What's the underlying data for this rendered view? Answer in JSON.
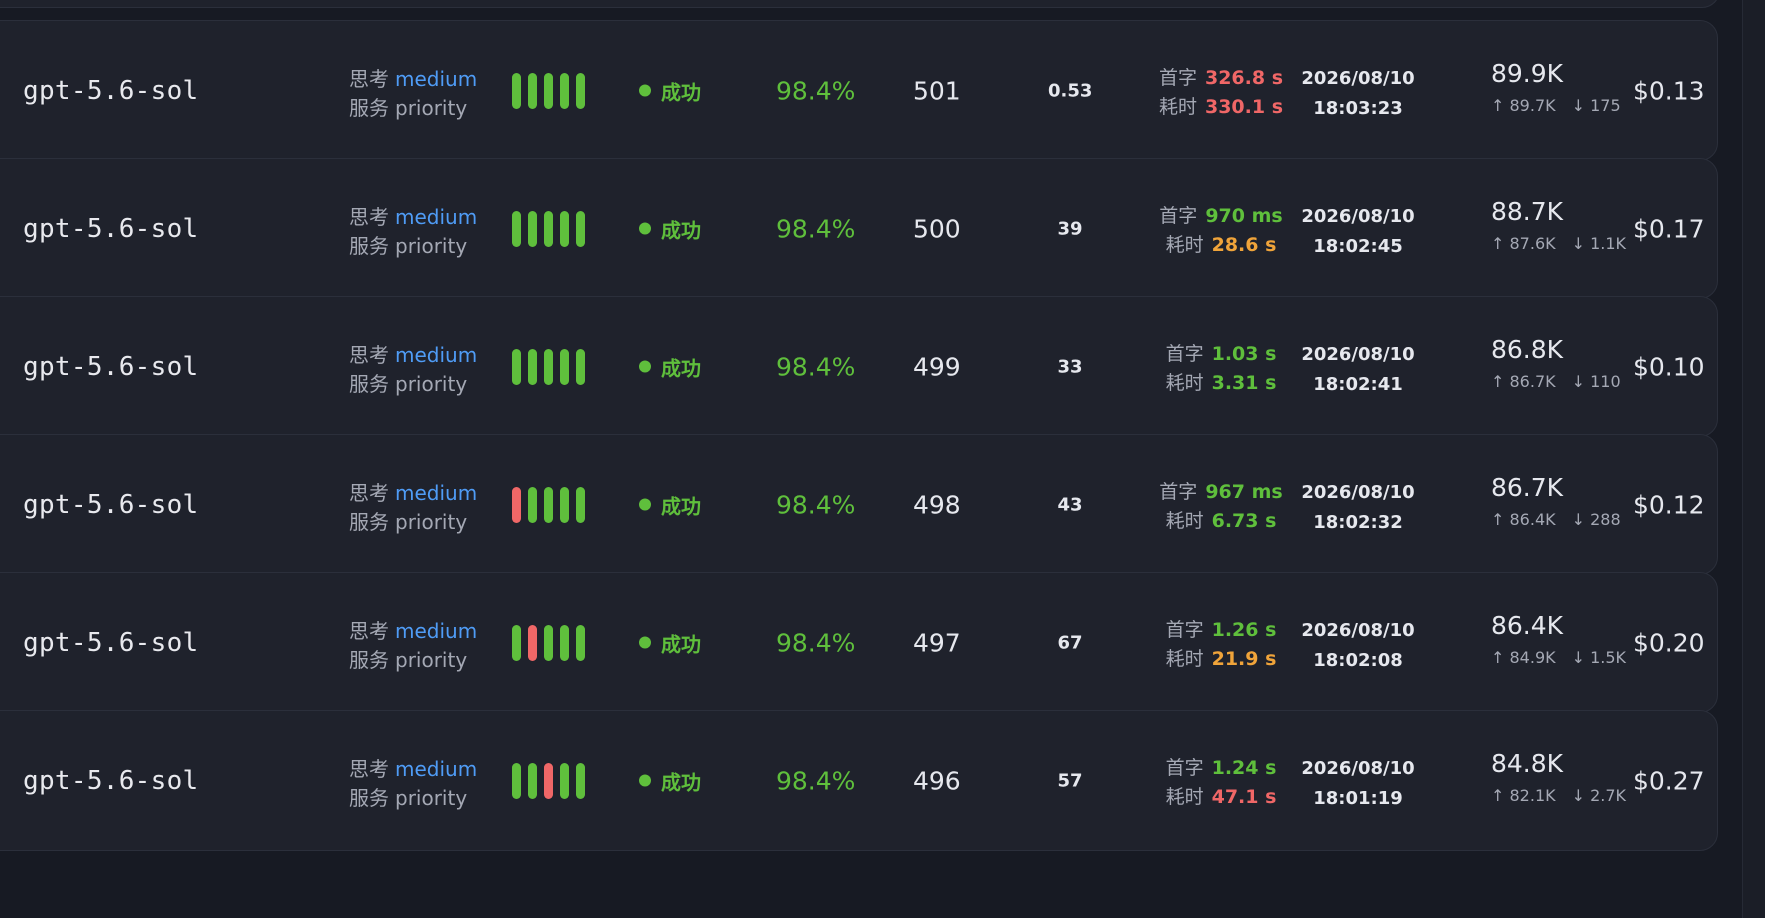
{
  "labels": {
    "think": "思考",
    "service": "服务",
    "first_token": "首字",
    "duration": "耗时"
  },
  "rows": [
    {
      "model": "gpt-5.6-sol",
      "think": "medium",
      "tier": "priority",
      "bars": [
        "ok",
        "ok",
        "ok",
        "ok",
        "ok"
      ],
      "status": "成功",
      "rate": "98.4%",
      "seq": "501",
      "tps": "0.53",
      "ttft": "326.8 s",
      "ttft_color": "red",
      "total_time": "330.1 s",
      "total_color": "red",
      "date": "2026/08/10",
      "time": "18:03:23",
      "tokens_total": "89.9K",
      "tokens_in": "↑ 89.7K",
      "tokens_out": "↓ 175",
      "cost": "$0.13"
    },
    {
      "model": "gpt-5.6-sol",
      "think": "medium",
      "tier": "priority",
      "bars": [
        "ok",
        "ok",
        "ok",
        "ok",
        "ok"
      ],
      "status": "成功",
      "rate": "98.4%",
      "seq": "500",
      "tps": "39",
      "ttft": "970 ms",
      "ttft_color": "green",
      "total_time": "28.6 s",
      "total_color": "orange",
      "date": "2026/08/10",
      "time": "18:02:45",
      "tokens_total": "88.7K",
      "tokens_in": "↑ 87.6K",
      "tokens_out": "↓ 1.1K",
      "cost": "$0.17"
    },
    {
      "model": "gpt-5.6-sol",
      "think": "medium",
      "tier": "priority",
      "bars": [
        "ok",
        "ok",
        "ok",
        "ok",
        "ok"
      ],
      "status": "成功",
      "rate": "98.4%",
      "seq": "499",
      "tps": "33",
      "ttft": "1.03 s",
      "ttft_color": "green",
      "total_time": "3.31 s",
      "total_color": "green",
      "date": "2026/08/10",
      "time": "18:02:41",
      "tokens_total": "86.8K",
      "tokens_in": "↑ 86.7K",
      "tokens_out": "↓ 110",
      "cost": "$0.10"
    },
    {
      "model": "gpt-5.6-sol",
      "think": "medium",
      "tier": "priority",
      "bars": [
        "fail",
        "ok",
        "ok",
        "ok",
        "ok"
      ],
      "status": "成功",
      "rate": "98.4%",
      "seq": "498",
      "tps": "43",
      "ttft": "967 ms",
      "ttft_color": "green",
      "total_time": "6.73 s",
      "total_color": "green",
      "date": "2026/08/10",
      "time": "18:02:32",
      "tokens_total": "86.7K",
      "tokens_in": "↑ 86.4K",
      "tokens_out": "↓ 288",
      "cost": "$0.12"
    },
    {
      "model": "gpt-5.6-sol",
      "think": "medium",
      "tier": "priority",
      "bars": [
        "ok",
        "fail",
        "ok",
        "ok",
        "ok"
      ],
      "status": "成功",
      "rate": "98.4%",
      "seq": "497",
      "tps": "67",
      "ttft": "1.26 s",
      "ttft_color": "green",
      "total_time": "21.9 s",
      "total_color": "orange",
      "date": "2026/08/10",
      "time": "18:02:08",
      "tokens_total": "86.4K",
      "tokens_in": "↑ 84.9K",
      "tokens_out": "↓ 1.5K",
      "cost": "$0.20"
    },
    {
      "model": "gpt-5.6-sol",
      "think": "medium",
      "tier": "priority",
      "bars": [
        "ok",
        "ok",
        "fail",
        "ok",
        "ok"
      ],
      "status": "成功",
      "rate": "98.4%",
      "seq": "496",
      "tps": "57",
      "ttft": "1.24 s",
      "ttft_color": "green",
      "total_time": "47.1 s",
      "total_color": "red",
      "date": "2026/08/10",
      "time": "18:01:19",
      "tokens_total": "84.8K",
      "tokens_in": "↑ 82.1K",
      "tokens_out": "↓ 2.7K",
      "cost": "$0.27"
    }
  ]
}
